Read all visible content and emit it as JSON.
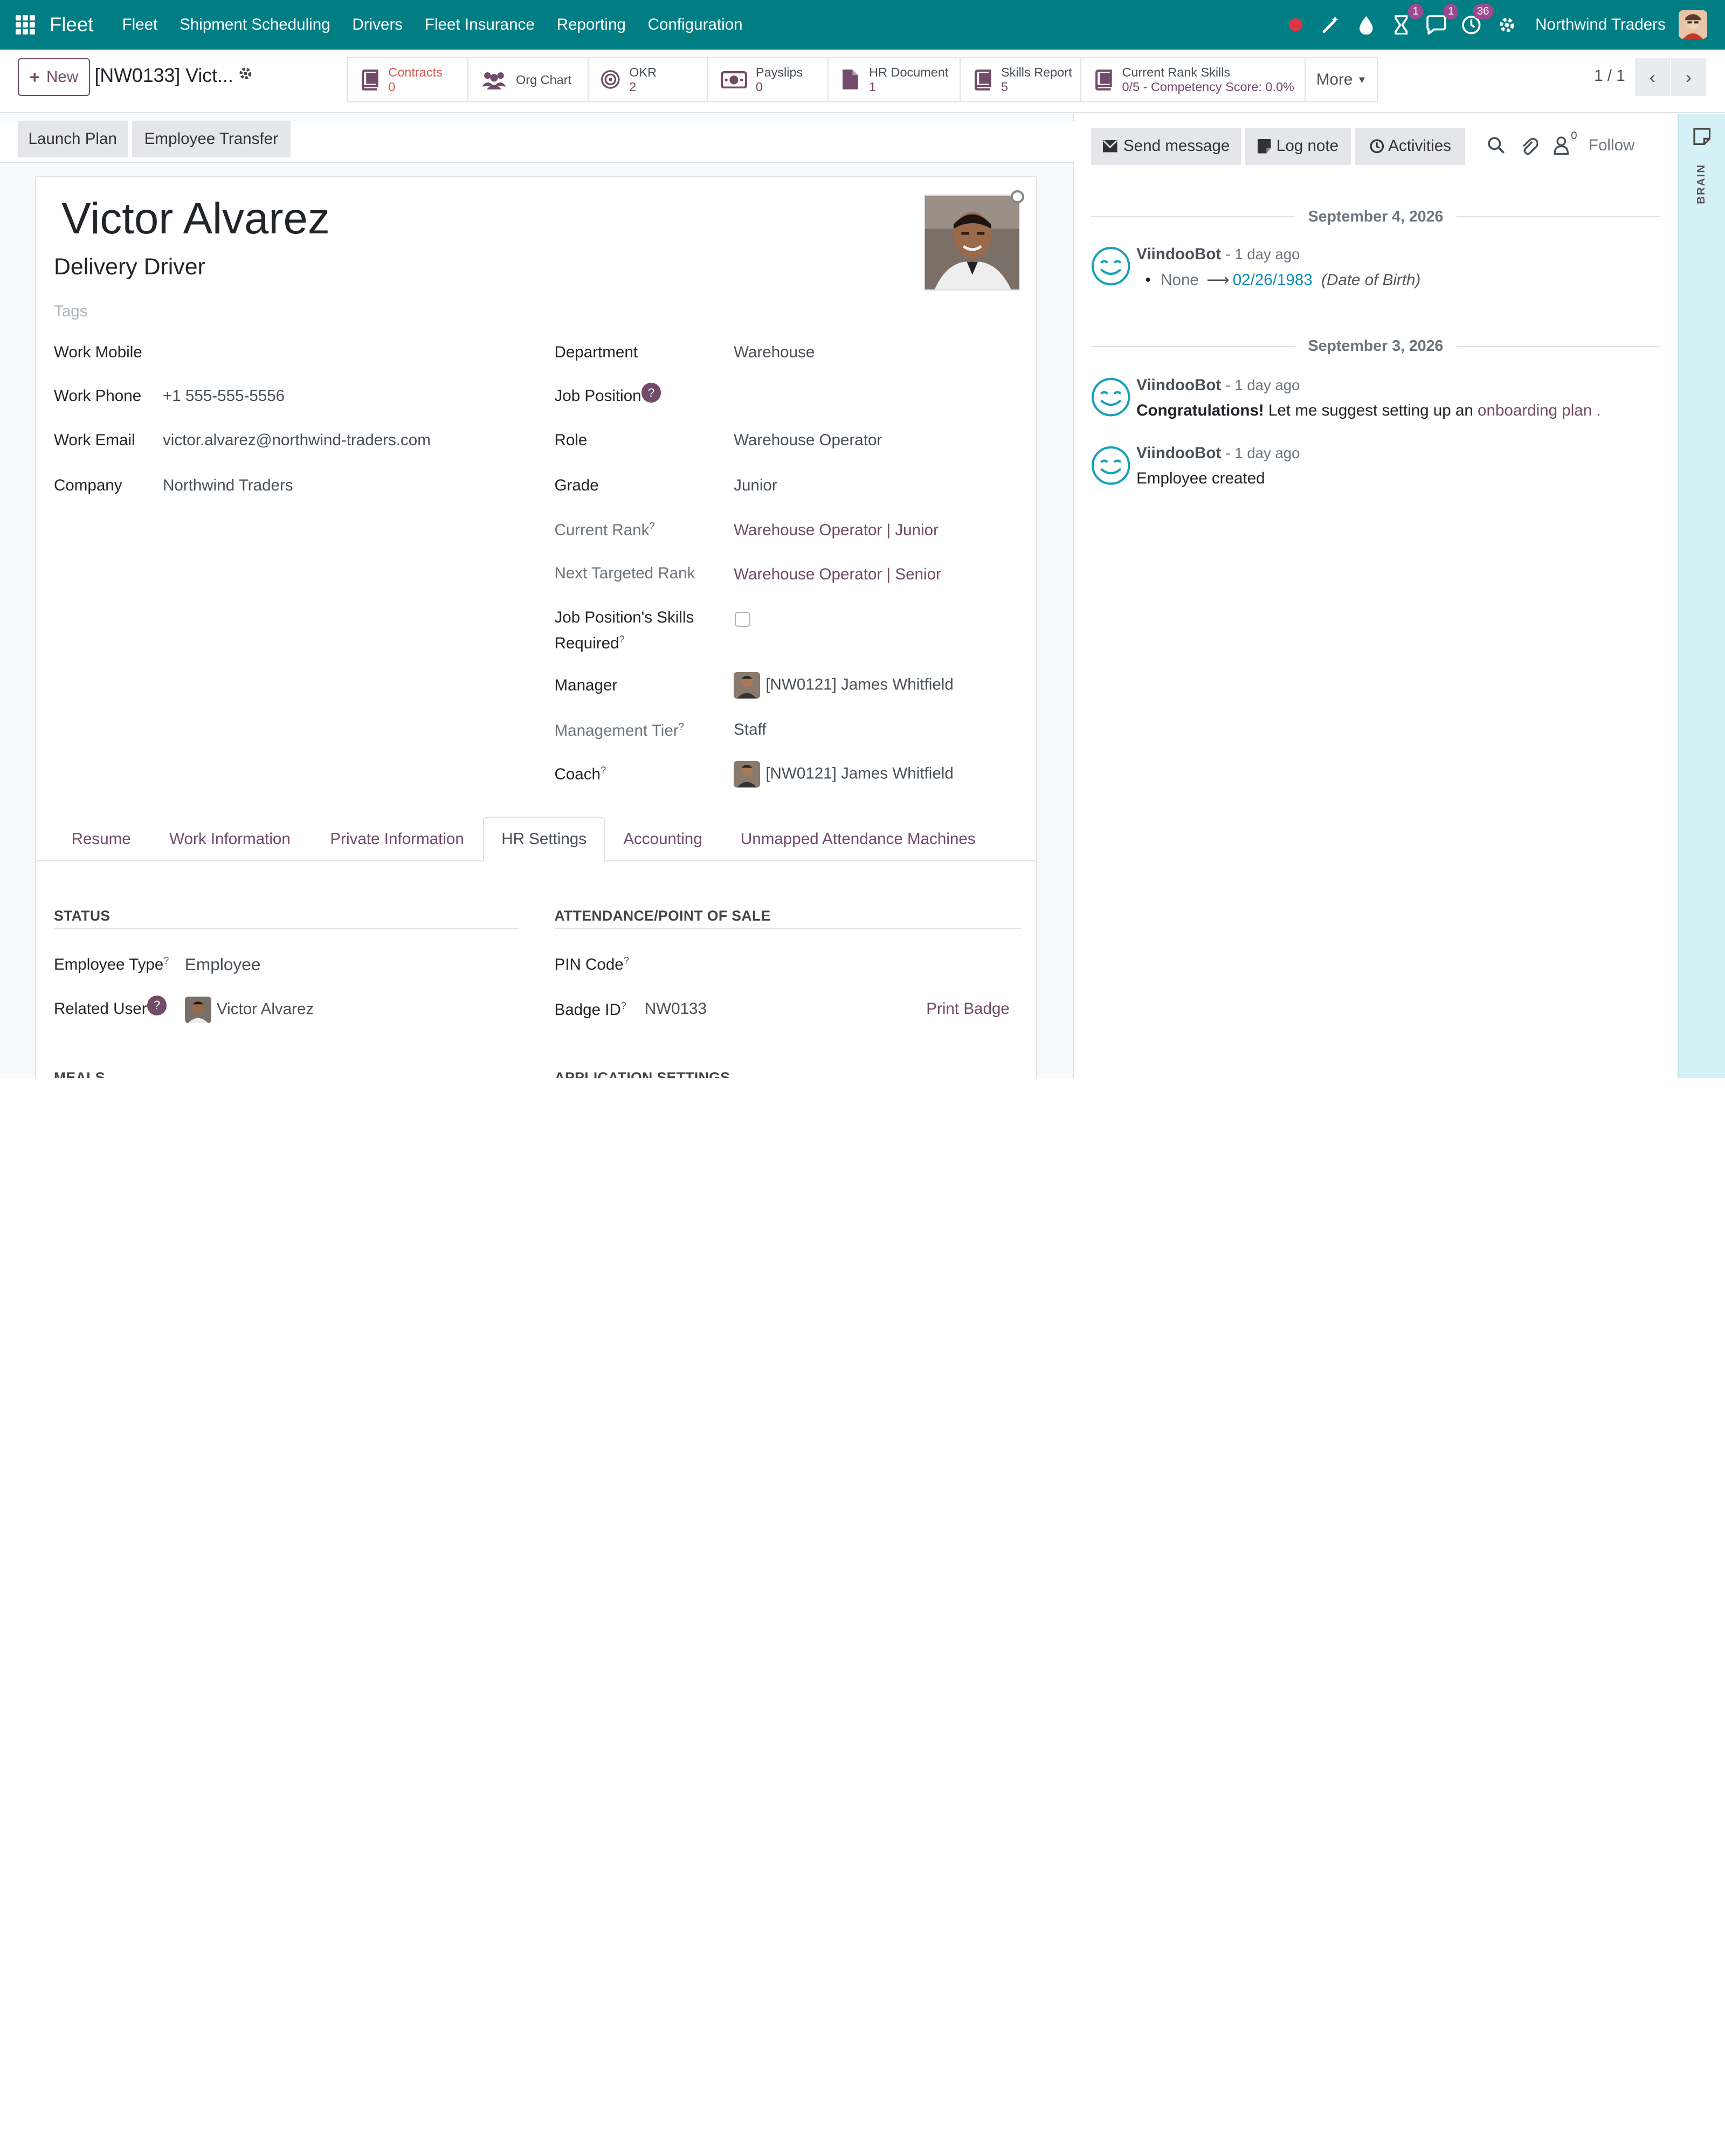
{
  "topnav": {
    "brand": "Fleet",
    "menu": [
      "Fleet",
      "Shipment Scheduling",
      "Drivers",
      "Fleet Insurance",
      "Reporting",
      "Configuration"
    ],
    "badges": {
      "activity": "1",
      "messages": "1",
      "clock": "36"
    },
    "company": "Northwind Traders"
  },
  "control": {
    "new_label": "New",
    "record_title": "[NW0133] Vict...",
    "smart_buttons": [
      {
        "label": "Contracts",
        "value": "0",
        "icon": "book-icon"
      },
      {
        "label": "Org Chart",
        "value": "",
        "icon": "users-icon"
      },
      {
        "label": "OKR",
        "value": "2",
        "icon": "target-icon"
      },
      {
        "label": "Payslips",
        "value": "0",
        "icon": "money-icon"
      },
      {
        "label": "HR Document",
        "value": "1",
        "icon": "file-icon"
      },
      {
        "label": "Skills Report",
        "value": "5",
        "icon": "book-icon"
      },
      {
        "label": "Current Rank Skills",
        "value": "0/5 - Competency Score: 0.0%",
        "icon": "book-icon"
      }
    ],
    "more": "More",
    "pager": "1 / 1"
  },
  "header_buttons": [
    "Launch Plan",
    "Employee Transfer"
  ],
  "employee": {
    "name": "Victor Alvarez",
    "job_title": "Delivery Driver",
    "tags_placeholder": "Tags"
  },
  "left_fields": {
    "work_mobile_label": "Work Mobile",
    "work_phone_label": "Work Phone",
    "work_phone": "+1 555-555-5556",
    "work_email_label": "Work Email",
    "work_email": "victor.alvarez@northwind-traders.com",
    "company_label": "Company",
    "company": "Northwind Traders"
  },
  "right_fields": {
    "department_label": "Department",
    "department": "Warehouse",
    "job_position_label": "Job Position",
    "role_label": "Role",
    "role": "Warehouse Operator",
    "grade_label": "Grade",
    "grade": "Junior",
    "current_rank_label": "Current Rank",
    "current_rank": "Warehouse Operator | Junior",
    "next_rank_label": "Next Targeted Rank",
    "next_rank": "Warehouse Operator | Senior",
    "skills_required_label_1": "Job Position's Skills",
    "skills_required_label_2": "Required",
    "manager_label": "Manager",
    "manager": "[NW0121] James Whitfield",
    "management_tier_label": "Management Tier",
    "management_tier": "Staff",
    "coach_label": "Coach",
    "coach": "[NW0121] James Whitfield"
  },
  "tabs": [
    "Resume",
    "Work Information",
    "Private Information",
    "HR Settings",
    "Accounting",
    "Unmapped Attendance Machines"
  ],
  "hr_settings": {
    "status_title": "STATUS",
    "attendance_title": "ATTENDANCE/POINT OF SALE",
    "employee_type_label": "Employee Type",
    "employee_type": "Employee",
    "related_user_label": "Related User",
    "related_user": "Victor Alvarez",
    "pin_code_label": "PIN Code",
    "badge_id_label": "Badge ID",
    "badge_id": "NW0133",
    "print_badge": "Print Badge",
    "meals_title": "MEALS",
    "app_settings_title": "APPLICATION SETTINGS"
  },
  "chatter": {
    "send_message": "Send message",
    "log_note": "Log note",
    "activities": "Activities",
    "follower_count": "0",
    "follow": "Follow",
    "dates": [
      "September 4, 2026",
      "September 3, 2026"
    ],
    "messages": [
      {
        "author": "ViindooBot",
        "ago": "- 1 day ago",
        "old": "None",
        "new": "02/26/1983",
        "field": "(Date of Birth)"
      },
      {
        "author": "ViindooBot",
        "ago": "- 1 day ago",
        "bold": "Congratulations!",
        "text": " Let me suggest setting up an ",
        "link": "onboarding plan",
        "tail": " ."
      },
      {
        "author": "ViindooBot",
        "ago": "- 1 day ago",
        "text": "Employee created"
      }
    ]
  },
  "sidebar": {
    "label": "BRAIN"
  },
  "colors": {
    "nav": "#017e84",
    "primary": "#714b67",
    "accent_blue": "#0d8bb1"
  }
}
